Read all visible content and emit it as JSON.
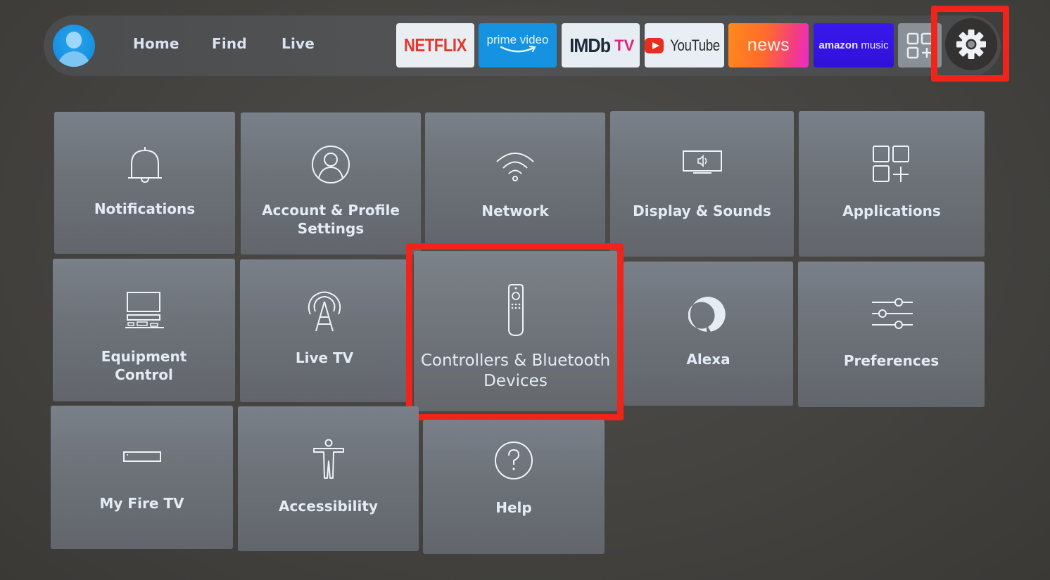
{
  "topbar": {
    "profile": {
      "icon": "user-avatar-icon"
    },
    "nav": [
      {
        "label": "Home"
      },
      {
        "label": "Find"
      },
      {
        "label": "Live"
      }
    ],
    "apps": [
      {
        "name": "Netflix",
        "label": "NETFLIX"
      },
      {
        "name": "Prime Video",
        "label": "prime video"
      },
      {
        "name": "IMDb TV",
        "label_a": "IMDb",
        "label_b": "TV"
      },
      {
        "name": "YouTube",
        "label": "YouTube"
      },
      {
        "name": "News",
        "label": "news"
      },
      {
        "name": "Amazon Music",
        "label_a": "amazon",
        "label_b": "music"
      }
    ],
    "all_apps": {
      "icon": "apps-grid-plus-icon"
    },
    "settings": {
      "icon": "gear-icon",
      "highlighted": true
    }
  },
  "settings_grid": {
    "tiles": [
      {
        "label": "Notifications",
        "icon": "bell-icon"
      },
      {
        "label": "Account & Profile Settings",
        "line1": "Account & Profile",
        "line2": "Settings",
        "icon": "profile-icon"
      },
      {
        "label": "Network",
        "icon": "wifi-icon"
      },
      {
        "label": "Display & Sounds",
        "icon": "display-sound-icon"
      },
      {
        "label": "Applications",
        "icon": "applications-icon"
      },
      {
        "label": "Equipment Control",
        "line1": "Equipment",
        "line2": "Control",
        "icon": "equipment-icon"
      },
      {
        "label": "Live TV",
        "icon": "antenna-icon"
      },
      {
        "label": "Controllers & Bluetooth Devices",
        "line1": "Controllers & Bluetooth",
        "line2": "Devices",
        "icon": "remote-icon",
        "focused": true,
        "highlighted": true
      },
      {
        "label": "Alexa",
        "icon": "alexa-icon"
      },
      {
        "label": "Preferences",
        "icon": "sliders-icon"
      },
      {
        "label": "My Fire TV",
        "icon": "fire-tv-device-icon"
      },
      {
        "label": "Accessibility",
        "icon": "accessibility-icon"
      },
      {
        "label": "Help",
        "icon": "help-icon"
      }
    ]
  },
  "colors": {
    "highlight_border": "#f0241b",
    "profile_blue": "#168fe0",
    "netflix_red": "#e5362b",
    "prime_blue": "#1592e0",
    "imdb_pink": "#e3207c",
    "youtube_red": "#ea2d20",
    "music_purple": "#3a18ee"
  }
}
